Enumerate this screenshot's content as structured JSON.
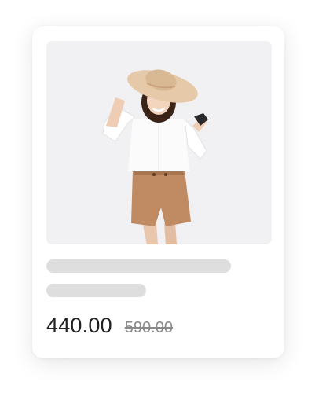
{
  "product_card": {
    "image_icon": "product-photo",
    "price_current": "440.00",
    "price_original": "590.00"
  },
  "colors": {
    "card_background": "#ffffff",
    "image_background": "#f1f1f3",
    "skeleton": "#dedede",
    "price_current": "#222222",
    "price_original": "#8a8a8a"
  }
}
